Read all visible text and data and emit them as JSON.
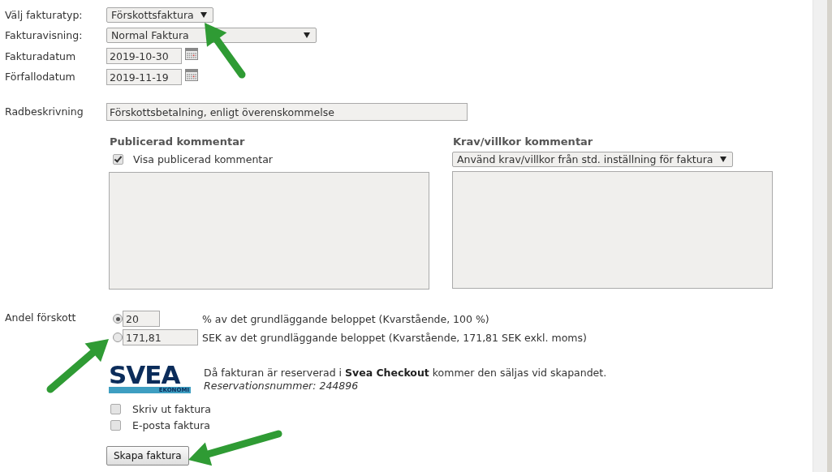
{
  "fields": [
    {
      "kind": "select",
      "label": "Välj fakturatyp:",
      "value": "Förskottsfaktura"
    },
    {
      "kind": "select",
      "label": "Fakturavisning:",
      "value": "Normal Faktura"
    },
    {
      "kind": "date",
      "label": "Fakturadatum",
      "value": "2019-10-30"
    },
    {
      "kind": "date",
      "label": "Förfallodatum",
      "value": "2019-11-19"
    }
  ],
  "line_description": {
    "label": "Radbeskrivning",
    "value": "Förskottsbetalning, enligt överenskommelse"
  },
  "published_comment": {
    "heading": "Publicerad kommentar",
    "checkbox": {
      "label": "Visa publicerad kommentar",
      "checked": true
    }
  },
  "terms_comment": {
    "heading": "Krav/villkor kommentar",
    "select": "Använd krav/villkor från std. inställning för faktura"
  },
  "advance": {
    "label": "Andel förskott",
    "options": [
      {
        "value": "20",
        "text": "% av det grundläggande beloppet (Kvarstående, 100 %)",
        "selected": true
      },
      {
        "value": "171,81",
        "text": "SEK av det grundläggande beloppet (Kvarstående, 171,81 SEK exkl. moms)",
        "selected": false
      }
    ]
  },
  "svea": {
    "logo": "SVEA",
    "logo_sub": "EKONOMI",
    "text": "Då fakturan är reserverad i **Svea Checkout** kommer den säljas vid skapandet.",
    "reservation": "Reservationsnummer: 244896"
  },
  "options": [
    {
      "label": "Skriv ut faktura",
      "checked": false
    },
    {
      "label": "E-posta faktura",
      "checked": false
    }
  ],
  "submit": "Skapa faktura",
  "annotations": [
    {
      "kind": "arrow"
    },
    {
      "kind": "arrow"
    },
    {
      "kind": "arrow"
    }
  ]
}
